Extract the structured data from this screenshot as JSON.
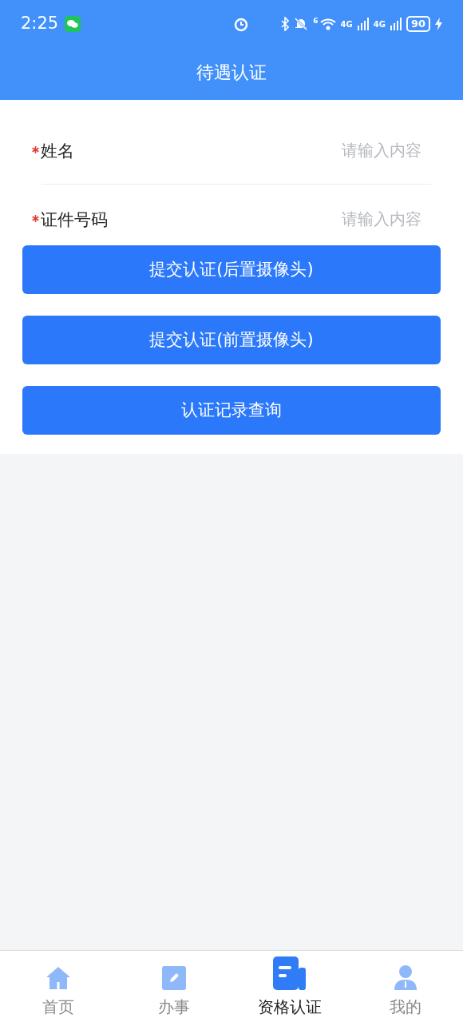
{
  "status_bar": {
    "time": "2:25",
    "wifi_badge": "6",
    "network_1": "4G",
    "network_2": "4G",
    "battery": "90"
  },
  "header": {
    "title": "待遇认证"
  },
  "fields": [
    {
      "label": "姓名",
      "required": true,
      "placeholder": "请输入内容"
    },
    {
      "label": "证件号码",
      "required": true,
      "placeholder": "请输入内容"
    }
  ],
  "buttons": [
    "提交认证(后置摄像头)",
    "提交认证(前置摄像头)",
    "认证记录查询"
  ],
  "tab_bar": [
    {
      "label": "首页",
      "kind": "home",
      "selected": false
    },
    {
      "label": "办事",
      "kind": "edit",
      "selected": false
    },
    {
      "label": "资格认证",
      "kind": "doc",
      "selected": true
    },
    {
      "label": "我的",
      "kind": "user",
      "selected": false
    }
  ]
}
